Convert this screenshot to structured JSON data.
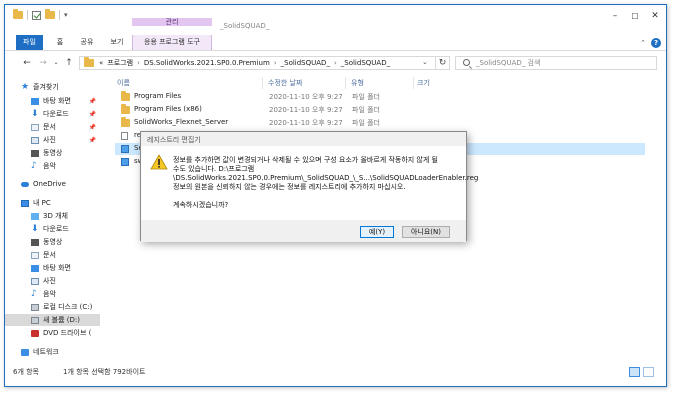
{
  "window": {
    "title": "_SolidSQUAD_",
    "context_tab_header": "관리",
    "colors": {
      "accent": "#1e6fc4",
      "context": "#e3c6ef",
      "selection": "#cce8ff"
    }
  },
  "ribbon": {
    "tabs": [
      "파일",
      "홈",
      "공유",
      "보기",
      "응용 프로그램 도구"
    ]
  },
  "address": {
    "prefix": "«",
    "crumbs": [
      "프로그램",
      "DS.SolidWorks.2021.SP0.0.Premium",
      "_SolidSQUAD_",
      "_SolidSQUAD_"
    ],
    "search_placeholder": "_SolidSQUAD_ 검색"
  },
  "sidebar": {
    "items": [
      {
        "label": "즐겨찾기",
        "icon": "star-icon"
      },
      {
        "label": "바탕 화면",
        "icon": "desktop-icon",
        "pinned": true
      },
      {
        "label": "다운로드",
        "icon": "download-icon",
        "pinned": true
      },
      {
        "label": "문서",
        "icon": "document-icon",
        "pinned": true
      },
      {
        "label": "사진",
        "icon": "picture-icon",
        "pinned": true
      },
      {
        "label": "동영상",
        "icon": "video-icon"
      },
      {
        "label": "음악",
        "icon": "music-icon"
      },
      {
        "label": "OneDrive",
        "icon": "cloud-icon"
      },
      {
        "label": "내 PC",
        "icon": "pc-icon"
      },
      {
        "label": "3D 개체",
        "icon": "cube-icon"
      },
      {
        "label": "다운로드",
        "icon": "download-icon"
      },
      {
        "label": "동영상",
        "icon": "video-icon"
      },
      {
        "label": "문서",
        "icon": "document-icon"
      },
      {
        "label": "바탕 화면",
        "icon": "desktop-icon"
      },
      {
        "label": "사진",
        "icon": "picture-icon"
      },
      {
        "label": "음악",
        "icon": "music-icon"
      },
      {
        "label": "로컬 디스크 (C:)",
        "icon": "drive-icon"
      },
      {
        "label": "새 볼륨 (D:)",
        "icon": "drive-icon",
        "selected": true
      },
      {
        "label": "DVD 드라이브 (",
        "icon": "dvd-icon"
      },
      {
        "label": "네트워크",
        "icon": "network-icon"
      }
    ]
  },
  "columns": [
    "이름",
    "수정한 날짜",
    "유형",
    "크기"
  ],
  "files": [
    {
      "name": "Program Files",
      "date": "2020-11-10 오후 9:27",
      "type": "파일 폴더",
      "size": "",
      "kind": "folder"
    },
    {
      "name": "Program Files (x86)",
      "date": "2020-11-10 오후 9:27",
      "type": "파일 폴더",
      "size": "",
      "kind": "folder"
    },
    {
      "name": "SolidWorks_Flexnet_Server",
      "date": "2020-11-10 오후 9:27",
      "type": "파일 폴더",
      "size": "",
      "kind": "folder"
    },
    {
      "name": "readr",
      "date": "",
      "type": "",
      "size": "",
      "kind": "text"
    },
    {
      "name": "Solid",
      "date": "",
      "type": "",
      "size": "",
      "kind": "reg",
      "selected": true
    },
    {
      "name": "sw2",
      "date": "",
      "type": "",
      "size": "",
      "kind": "reg"
    }
  ],
  "status": {
    "count": "6개 항목",
    "selection": "1개 항목 선택함 792바이트"
  },
  "dialog": {
    "title": "레지스트리 편집기",
    "message_line1": "정보를 추가하면 값이 변경되거나 삭제될 수 있으며 구성 요소가 올바르게 작동하지 않게 될",
    "message_line2": "수도 있습니다. D:\\프로그램",
    "message_line3": "\\DS.SolidWorks.2021.SP0.0.Premium\\_SolidSQUAD_\\_S...\\SolidSQUADLoaderEnabler.reg",
    "message_line4": "정보의 원본을 신뢰하지 않는 경우에는 정보를 레지스트리에 추가하지 마십시오.",
    "question": "계속하시겠습니까?",
    "yes_label": "예(Y)",
    "no_label": "아니요(N)"
  }
}
